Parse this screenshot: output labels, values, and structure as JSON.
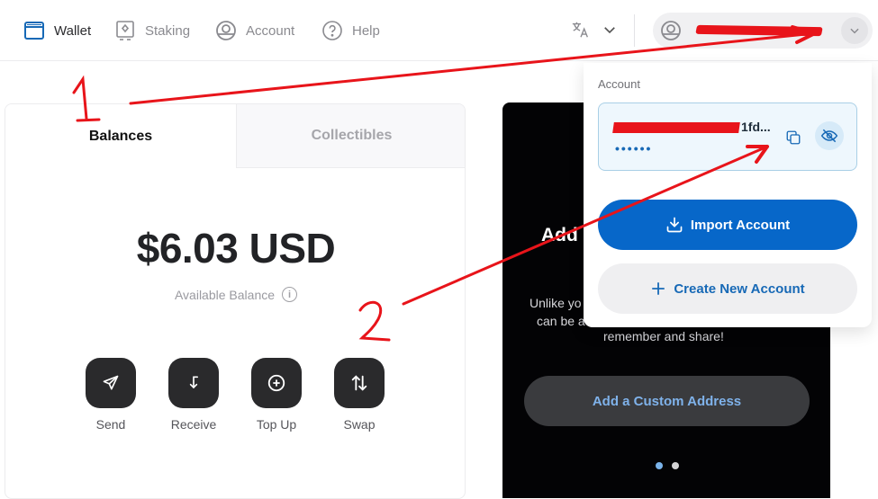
{
  "nav": {
    "items": [
      {
        "label": "Wallet",
        "icon": "wallet-icon",
        "active": true
      },
      {
        "label": "Staking",
        "icon": "staking-icon",
        "active": false
      },
      {
        "label": "Account",
        "icon": "account-icon",
        "active": false
      },
      {
        "label": "Help",
        "icon": "help-icon",
        "active": false
      }
    ],
    "language_icon": "translate-icon",
    "account_pill": {
      "name": "[redacted]"
    }
  },
  "tabs": [
    {
      "label": "Balances",
      "active": true
    },
    {
      "label": "Collectibles",
      "active": false
    }
  ],
  "balance": {
    "amount": "$6.03 USD",
    "label": "Available Balance"
  },
  "actions": [
    {
      "label": "Send",
      "icon": "send-icon"
    },
    {
      "label": "Receive",
      "icon": "receive-icon"
    },
    {
      "label": "Top Up",
      "icon": "top-up-icon"
    },
    {
      "label": "Swap",
      "icon": "swap-icon"
    }
  ],
  "promo": {
    "title_visible": "Add",
    "text_line1": "Unlike yo",
    "text_line2": "can be a",
    "text_line3": "remember and share!",
    "button_label": "Add a Custom Address",
    "slides": 2,
    "active_slide": 1
  },
  "dropdown": {
    "section_label": "Account",
    "account": {
      "name_suffix": "1fd...",
      "masked_balance": "••••••"
    },
    "import_label": "Import Account",
    "create_label": "Create New Account"
  },
  "annotations": {
    "label_1": "1",
    "label_2": "2",
    "color": "#e8141a"
  },
  "colors": {
    "accent": "#0767c9",
    "link": "#1769b6",
    "dark_button": "#2a2a2c"
  }
}
